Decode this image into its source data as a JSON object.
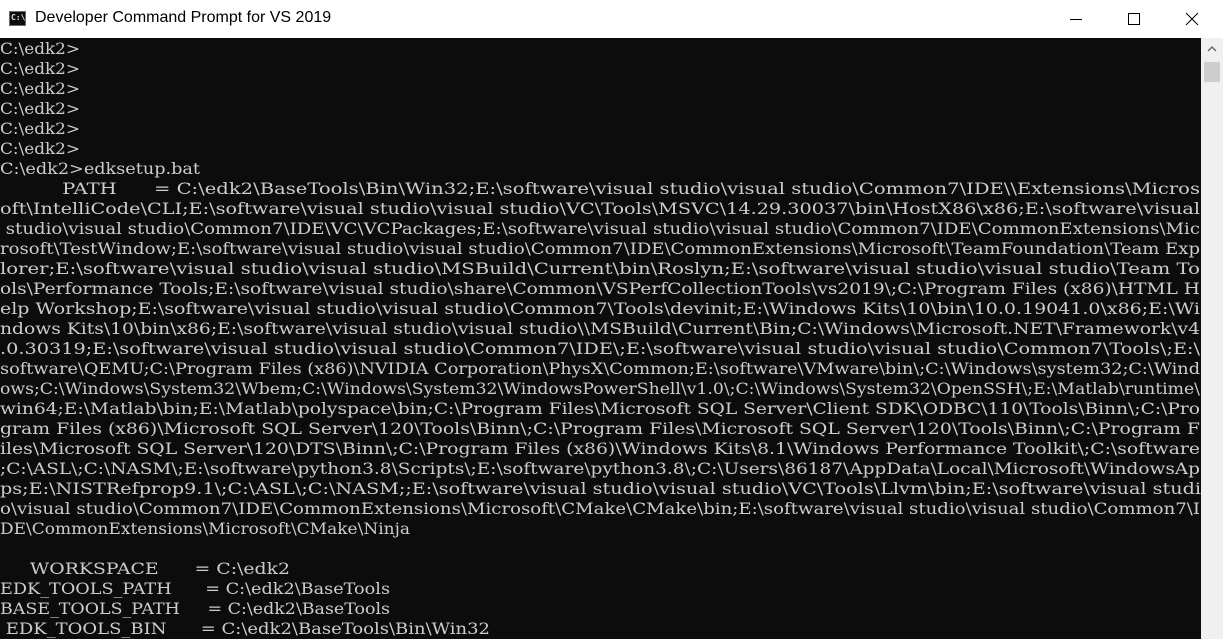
{
  "window": {
    "title": "Developer Command Prompt for VS 2019",
    "icon": "cmd-icon",
    "icon_text": "C:\\"
  },
  "console": {
    "lines": [
      "C:\\edk2>",
      "C:\\edk2>",
      "C:\\edk2>",
      "C:\\edk2>",
      "C:\\edk2>",
      "C:\\edk2>",
      "C:\\edk2>edksetup.bat",
      "          PATH      = C:\\edk2\\BaseTools\\Bin\\Win32;E:\\software\\visual studio\\visual studio\\Common7\\IDE\\\\Extensions\\Micros",
      "oft\\IntelliCode\\CLI;E:\\software\\visual studio\\visual studio\\VC\\Tools\\MSVC\\14.29.30037\\bin\\HostX86\\x86;E:\\software\\visual",
      " studio\\visual studio\\Common7\\IDE\\VC\\VCPackages;E:\\software\\visual studio\\visual studio\\Common7\\IDE\\CommonExtensions\\Mic",
      "rosoft\\TestWindow;E:\\software\\visual studio\\visual studio\\Common7\\IDE\\CommonExtensions\\Microsoft\\TeamFoundation\\Team Exp",
      "lorer;E:\\software\\visual studio\\visual studio\\MSBuild\\Current\\bin\\Roslyn;E:\\software\\visual studio\\visual studio\\Team To",
      "ols\\Performance Tools;E:\\software\\visual studio\\share\\Common\\VSPerfCollectionTools\\vs2019\\;C:\\Program Files (x86)\\HTML H",
      "elp Workshop;E:\\software\\visual studio\\visual studio\\Common7\\Tools\\devinit;E:\\Windows Kits\\10\\bin\\10.0.19041.0\\x86;E:\\Wi",
      "ndows Kits\\10\\bin\\x86;E:\\software\\visual studio\\visual studio\\\\MSBuild\\Current\\Bin;C:\\Windows\\Microsoft.NET\\Framework\\v4",
      ".0.30319;E:\\software\\visual studio\\visual studio\\Common7\\IDE\\;E:\\software\\visual studio\\visual studio\\Common7\\Tools\\;E:\\",
      "software\\QEMU;C:\\Program Files (x86)\\NVIDIA Corporation\\PhysX\\Common;E:\\software\\VMware\\bin\\;C:\\Windows\\system32;C:\\Wind",
      "ows;C:\\Windows\\System32\\Wbem;C:\\Windows\\System32\\WindowsPowerShell\\v1.0\\;C:\\Windows\\System32\\OpenSSH\\;E:\\Matlab\\runtime\\",
      "win64;E:\\Matlab\\bin;E:\\Matlab\\polyspace\\bin;C:\\Program Files\\Microsoft SQL Server\\Client SDK\\ODBC\\110\\Tools\\Binn\\;C:\\Pro",
      "gram Files (x86)\\Microsoft SQL Server\\120\\Tools\\Binn\\;C:\\Program Files\\Microsoft SQL Server\\120\\Tools\\Binn\\;C:\\Program F",
      "iles\\Microsoft SQL Server\\120\\DTS\\Binn\\;C:\\Program Files (x86)\\Windows Kits\\8.1\\Windows Performance Toolkit\\;C:\\software",
      ";C:\\ASL\\;C:\\NASM\\;E:\\software\\python3.8\\Scripts\\;E:\\software\\python3.8\\;C:\\Users\\86187\\AppData\\Local\\Microsoft\\WindowsAp",
      "ps;E:\\NISTRefprop9.1\\;C:\\ASL\\;C:\\NASM;;E:\\software\\visual studio\\visual studio\\VC\\Tools\\Llvm\\bin;E:\\software\\visual studi",
      "o\\visual studio\\Common7\\IDE\\CommonExtensions\\Microsoft\\CMake\\CMake\\bin;E:\\software\\visual studio\\visual studio\\Common7\\I",
      "DE\\CommonExtensions\\Microsoft\\CMake\\Ninja",
      "",
      "     WORKSPACE      = C:\\edk2",
      "EDK_TOOLS_PATH      = C:\\edk2\\BaseTools",
      "BASE_TOOLS_PATH     = C:\\edk2\\BaseTools",
      " EDK_TOOLS_BIN      = C:\\edk2\\BaseTools\\Bin\\Win32"
    ]
  },
  "colors": {
    "console_bg": "#0c0c0c",
    "console_fg": "#cccccc",
    "titlebar_bg": "#ffffff"
  }
}
